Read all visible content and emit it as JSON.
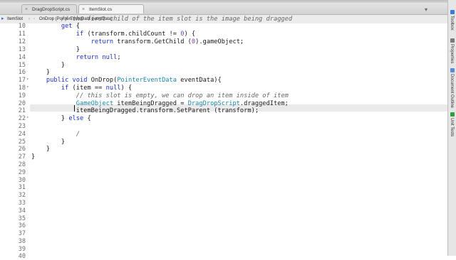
{
  "tabs": [
    {
      "label": "DragDropScript.cs",
      "active": false
    },
    {
      "label": "ItemSlot.cs",
      "active": true
    }
  ],
  "tab_overflow_icon": "chevron-down-icon",
  "breadcrumb": {
    "class_name": "ItemSlot",
    "separator": "›",
    "method_signature": "OnDrop (PointerEventData eventData)"
  },
  "editor": {
    "current_line": 23,
    "line_numbers": [
      "",
      "10",
      "11",
      "12",
      "13",
      "14",
      "15",
      "16",
      "17",
      "18",
      "19",
      "20",
      "21",
      "22",
      "23",
      "24",
      "25",
      "26",
      "27",
      "28",
      "29",
      "30",
      "31",
      "32",
      "33",
      "34",
      "35",
      "36",
      "37",
      "38",
      "39",
      "40"
    ],
    "lines": [
      "        // the first child of the item slot is the image being dragged",
      "        get {",
      "            if (transform.childCount != 0) {",
      "                return transform.GetChild (0).gameObject;",
      "            }",
      "            return null;",
      "        }",
      "    }",
      "    public void OnDrop(PointerEventData eventData){",
      "        if (item == null) {",
      "            // this slot is empty, we can drop an item inside of item",
      "            GameObject itemBeingDragged = DragDropScript.draggedItem;",
      "            itemBeingDragged.transform.SetParent (transform);",
      "        } else {",
      "",
      "            /",
      "        }",
      "    }",
      "}"
    ]
  },
  "right_panel": [
    {
      "label": "Toolbox",
      "color": "#3a7bd5"
    },
    {
      "label": "Properties",
      "color": "#7a7a7a"
    },
    {
      "label": "Document Outline",
      "color": "#5a8ad6"
    },
    {
      "label": "Unit Tests",
      "color": "#2e9e43"
    }
  ],
  "colors": {
    "keyword": "#1c2fc9",
    "type": "#1c86a8",
    "number": "#7a3db8",
    "comment": "#666666",
    "current_line": "#eaeaea"
  }
}
